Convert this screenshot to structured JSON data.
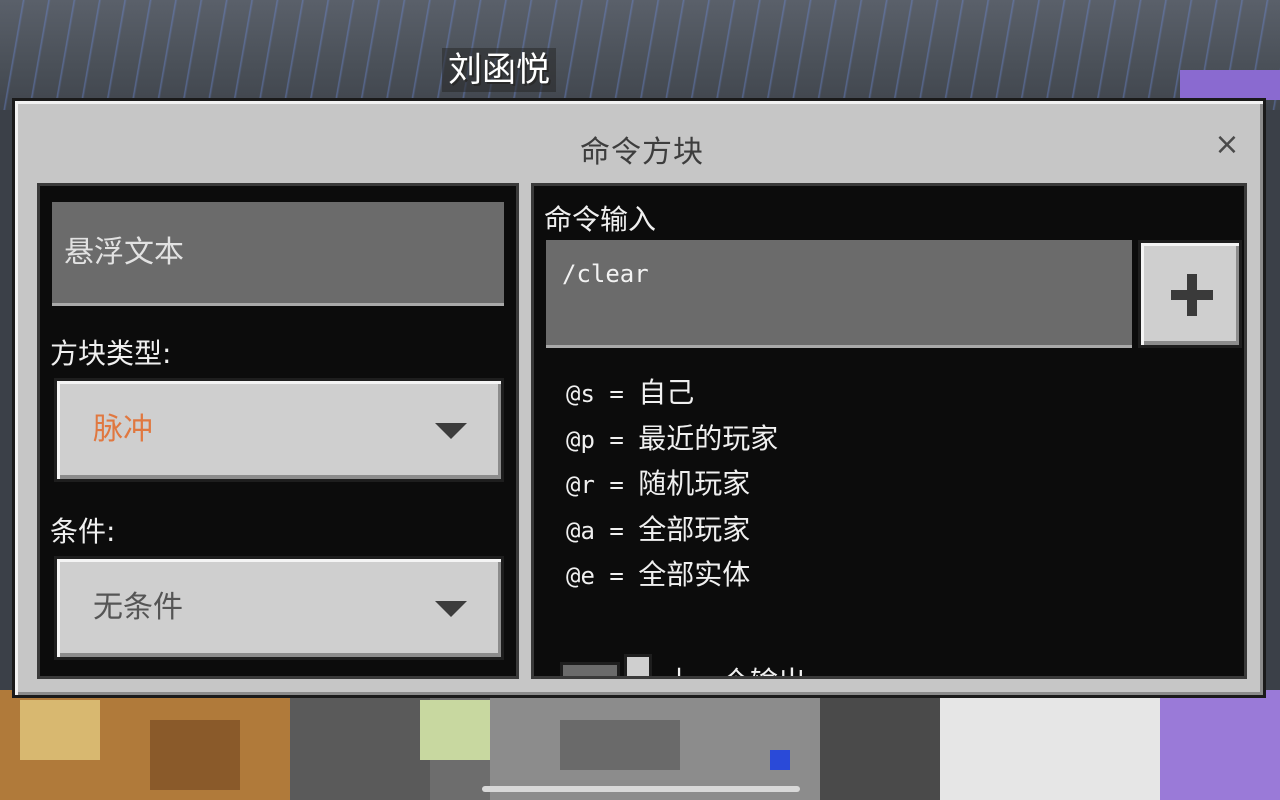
{
  "world": {
    "player_name": "刘函悦"
  },
  "dialog": {
    "title": "命令方块",
    "close_glyph": "×"
  },
  "left": {
    "hover_text": "悬浮文本",
    "block_type_label": "方块类型:",
    "block_type_value": "脉冲",
    "block_type_color": "#e07840",
    "condition_label": "条件:",
    "condition_value": "无条件",
    "condition_color": "#555555"
  },
  "right": {
    "command_label": "命令输入",
    "command_value": "/clear",
    "add_button_icon": "plus-icon",
    "selectors": [
      {
        "code": "@s",
        "desc": "自己"
      },
      {
        "code": "@p",
        "desc": "最近的玩家"
      },
      {
        "code": "@r",
        "desc": "随机玩家"
      },
      {
        "code": "@a",
        "desc": "全部玩家"
      },
      {
        "code": "@e",
        "desc": "全部实体"
      }
    ],
    "toggle_label": "上一个输出"
  }
}
